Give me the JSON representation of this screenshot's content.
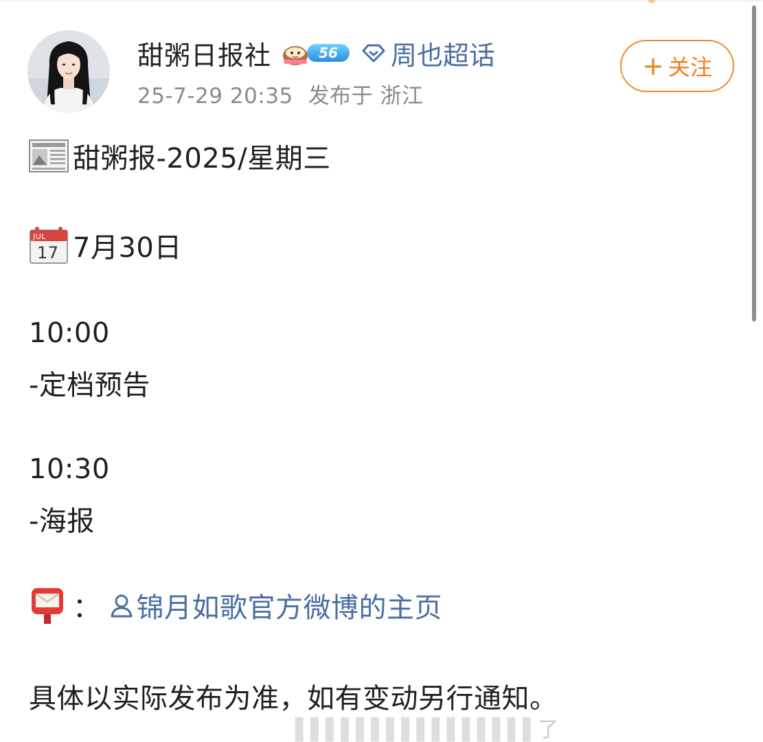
{
  "post": {
    "author_name": "甜粥日报社",
    "level": "56",
    "super_topic": "周也超话",
    "timestamp": "25-7-29 20:35",
    "published_from": "发布于 浙江",
    "follow_label": "关注",
    "follow_plus": "+"
  },
  "content": {
    "headline": "甜粥报-2025/星期三",
    "date": "7月30日",
    "item1_time": "10:00",
    "item1_desc": "-定档预告",
    "item2_time": "10:30",
    "item2_desc": "-海报",
    "mailbox_colon": "：",
    "profile_link": "锦月如歌官方微博的主页",
    "notice": "具体以实际发布为准，如有变动另行通知。",
    "faded_tail": "了"
  },
  "colors": {
    "link": "#4a6ea2",
    "follow_accent": "#f0801d",
    "meta_gray": "#8a8a8a"
  },
  "icons": {
    "newspaper": "newspaper-icon",
    "calendar": "calendar-icon",
    "mailbox": "postbox-icon",
    "person": "person-icon",
    "diamond": "diamond-icon"
  }
}
